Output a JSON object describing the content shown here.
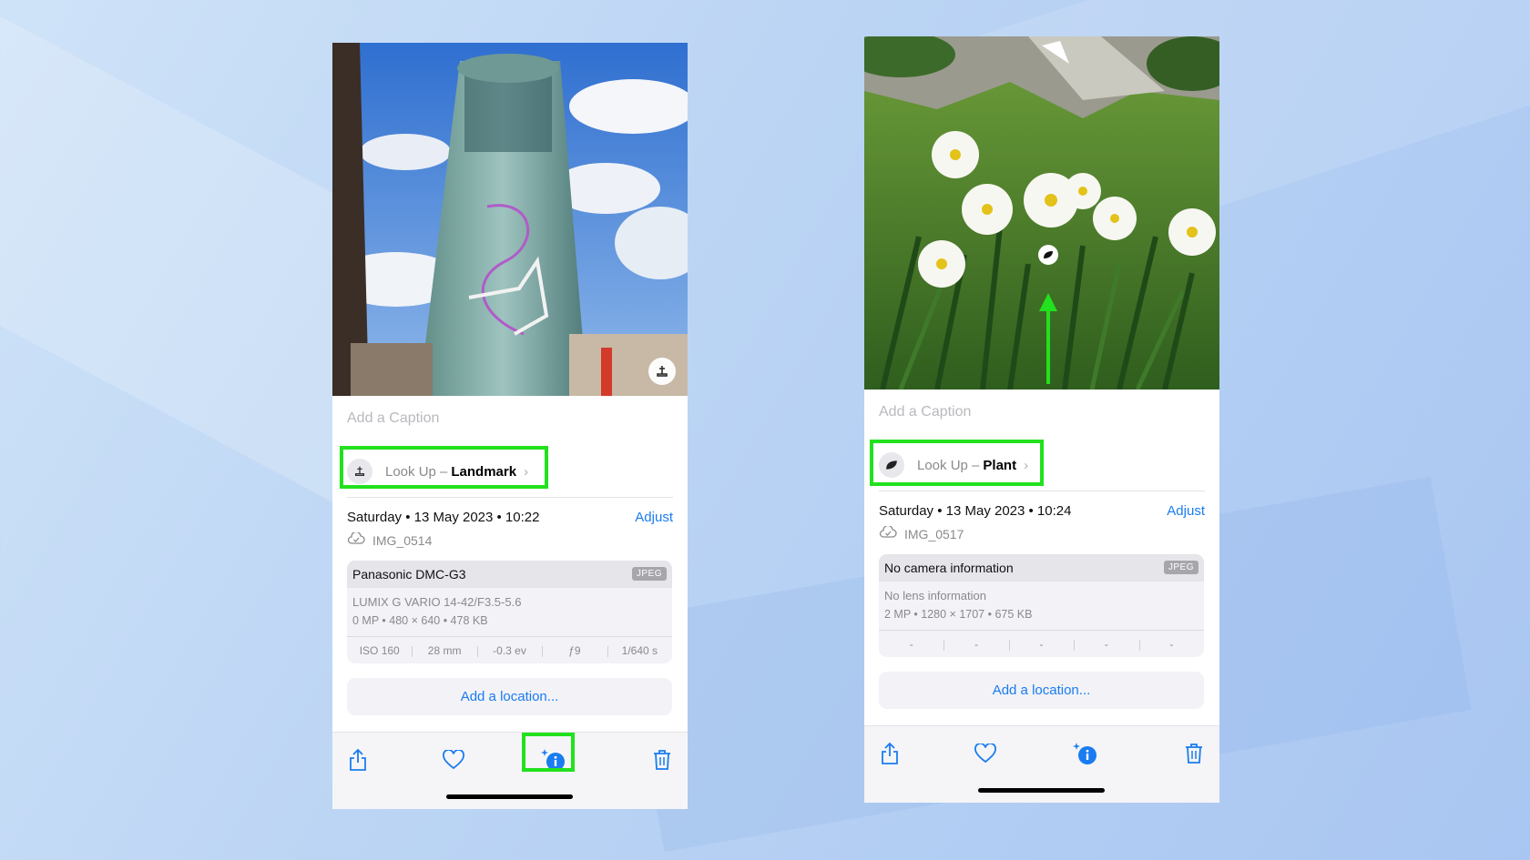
{
  "left_phone": {
    "caption_placeholder": "Add a Caption",
    "lookup": {
      "prefix": "Look Up –",
      "type": "Landmark",
      "icon": "landmark-icon"
    },
    "date": "Saturday • 13 May 2023 • 10:22",
    "adjust": "Adjust",
    "file_name": "IMG_0514",
    "camera": "Panasonic DMC-G3",
    "format": "JPEG",
    "lens": "LUMIX G VARIO 14-42/F3.5-5.6",
    "specs": "0 MP  •  480 × 640  •  478 KB",
    "params": [
      "ISO 160",
      "28 mm",
      "-0.3 ev",
      "ƒ9",
      "1/640 s"
    ],
    "add_location": "Add a location..."
  },
  "right_phone": {
    "caption_placeholder": "Add a Caption",
    "lookup": {
      "prefix": "Look Up –",
      "type": "Plant",
      "icon": "leaf-icon"
    },
    "date": "Saturday • 13 May 2023 • 10:24",
    "adjust": "Adjust",
    "file_name": "IMG_0517",
    "camera": "No camera information",
    "format": "JPEG",
    "lens": "No lens information",
    "specs": "2 MP  •  1280 × 1707  •  675 KB",
    "params": [
      "-",
      "-",
      "-",
      "-",
      "-"
    ],
    "add_location": "Add a location..."
  },
  "toolbar_icons": [
    "share-icon",
    "heart-icon",
    "info-sparkle-icon",
    "trash-icon"
  ],
  "colors": {
    "accent": "#1a7cf0",
    "highlight": "#22e11d",
    "background": "#bcd5f4"
  }
}
